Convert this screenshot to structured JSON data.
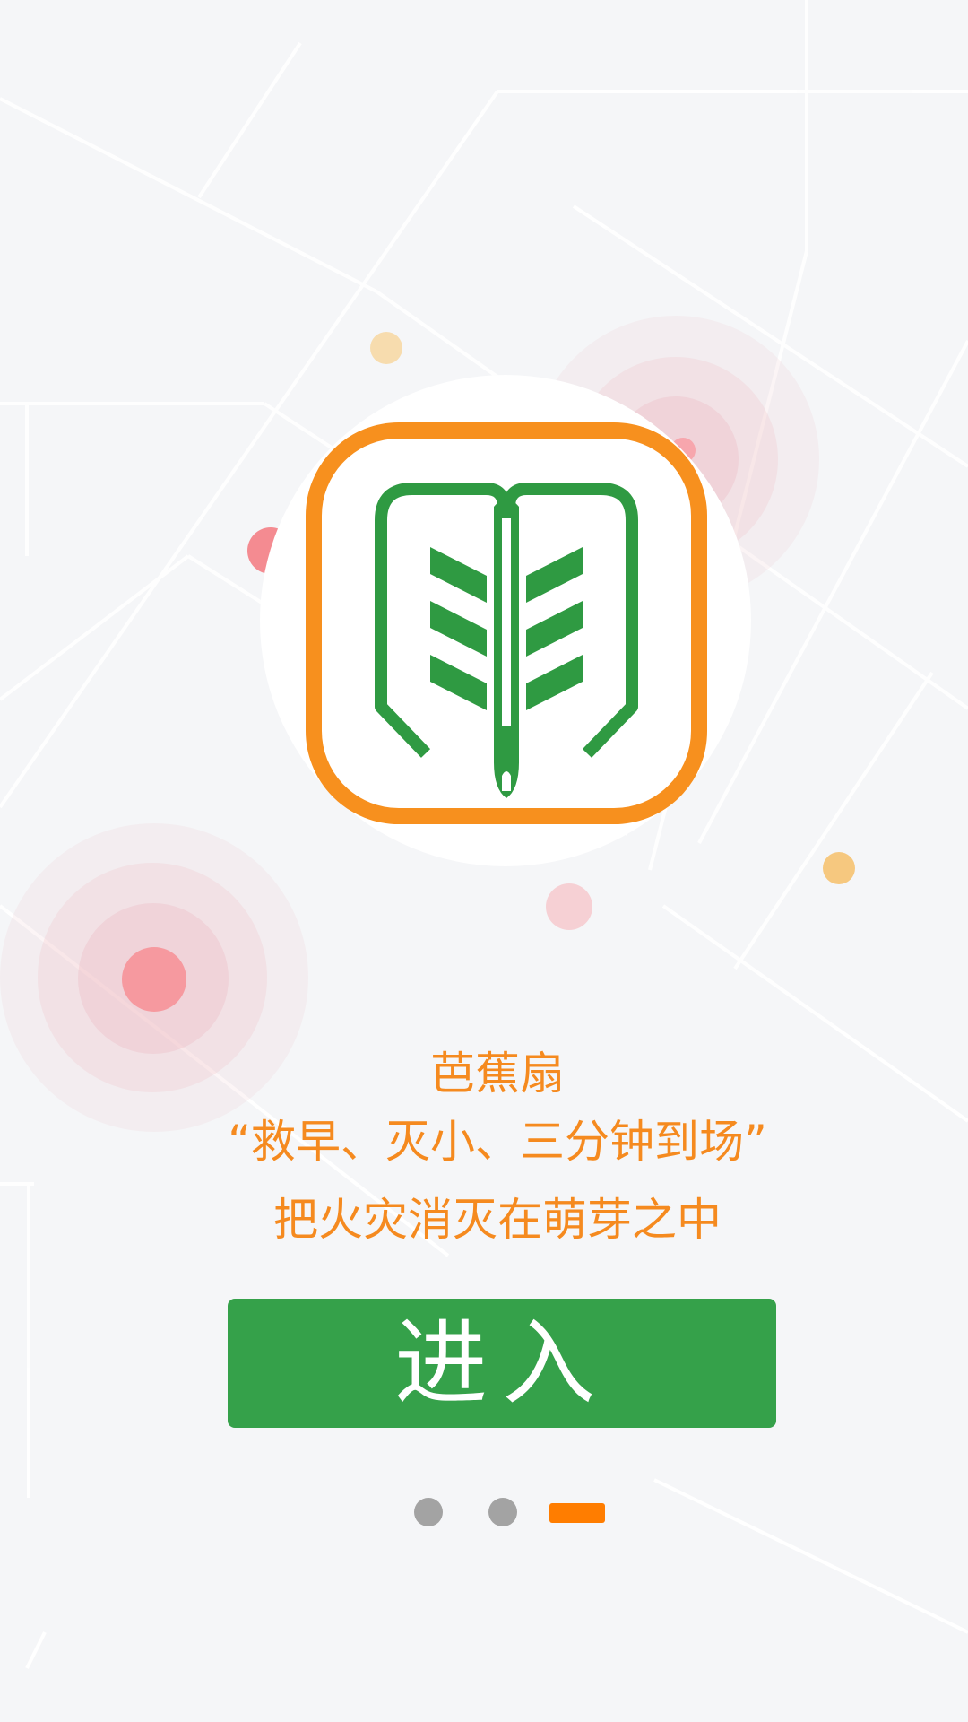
{
  "app": {
    "name": "芭蕉扇"
  },
  "logo": {
    "icon": "leaf-logo-icon",
    "frame_color": "#f7901e",
    "leaf_color": "#2f9a42"
  },
  "slogan": {
    "line1": "芭蕉扇",
    "line2": "“救早、灭小、三分钟到场”",
    "line3": "把火灾消灭在萌芽之中"
  },
  "enter_button": {
    "label": "进入",
    "color": "#35a14a"
  },
  "pagination": {
    "total": 3,
    "current": 3,
    "active_color": "#ff7d00",
    "inactive_color": "#a3a3a3"
  }
}
